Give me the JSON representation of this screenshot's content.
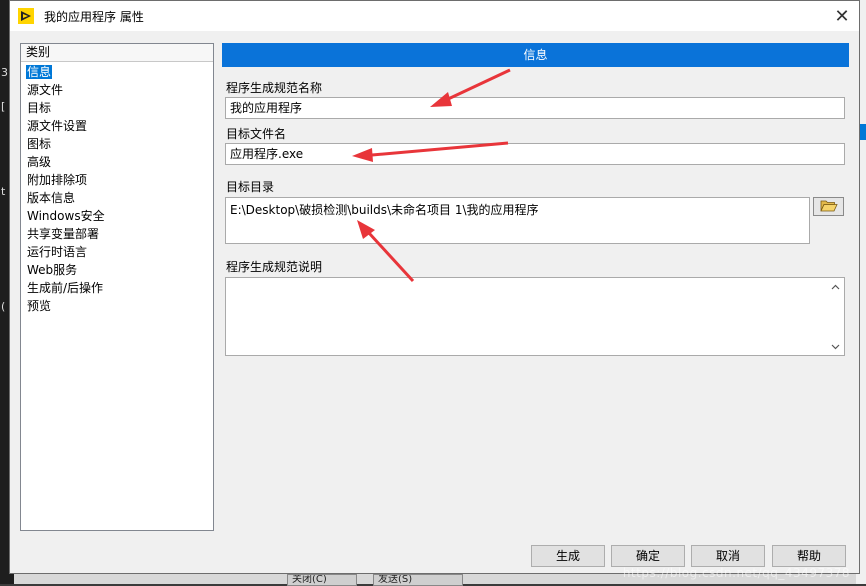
{
  "dialog": {
    "title": "我的应用程序 属性",
    "close_glyph": "✕"
  },
  "category": {
    "header": "类别",
    "items": [
      "信息",
      "源文件",
      "目标",
      "源文件设置",
      "图标",
      "高级",
      "附加排除项",
      "版本信息",
      "Windows安全",
      "共享变量部署",
      "运行时语言",
      "Web服务",
      "生成前/后操作",
      "预览"
    ],
    "selected_index": 0
  },
  "info": {
    "section_title": "信息",
    "spec_name_label": "程序生成规范名称",
    "spec_name_value": "我的应用程序",
    "target_file_label": "目标文件名",
    "target_file_value": "应用程序.exe",
    "target_dir_label": "目标目录",
    "target_dir_value": "E:\\Desktop\\破损检测\\builds\\未命名项目 1\\我的应用程序",
    "description_label": "程序生成规范说明",
    "description_value": ""
  },
  "buttons": {
    "build": "生成",
    "ok": "确定",
    "cancel": "取消",
    "help": "帮助"
  },
  "background": {
    "left_marks": [
      "3",
      "[",
      "t",
      "("
    ],
    "bottom_btn_close": "关闭(C)",
    "bottom_btn_send": "发送(S)",
    "watermark": "https://blog.csdn.net/qq_43497378"
  },
  "colors": {
    "accent": "#0078d7",
    "section_header": "#0a73d9",
    "arrow": "#e8353a"
  }
}
